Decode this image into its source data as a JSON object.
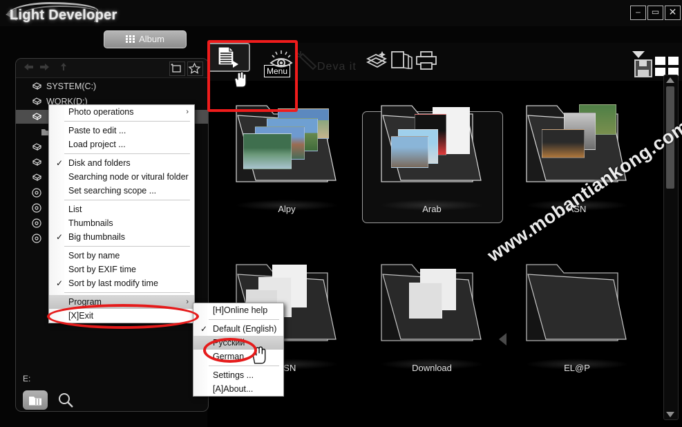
{
  "window": {
    "title": "Light Developer",
    "minimize_label": "–",
    "maximize_label": "▭",
    "close_label": "✕"
  },
  "tabs": {
    "album_label": "Album"
  },
  "toolbar": {
    "menu_tooltip": "Menu",
    "deva_label": "Deva it",
    "icons": [
      "menu-document-icon",
      "eye-preview-icon",
      "magic-wand-icon",
      "layers-icon",
      "copy-pages-icon",
      "print-icon"
    ],
    "right_icons": [
      "dropdown-triangle-icon",
      "save-floppy-icon",
      "grid-view-icon"
    ]
  },
  "browser": {
    "nav": {
      "back": "←",
      "forward": "→",
      "up": "↑"
    },
    "new_folder_icon": "new-folder-icon",
    "favorite_icon": "star-icon",
    "tree": [
      {
        "label": "SYSTEM(C:)",
        "icon": "disk-icon",
        "selected": false,
        "indent": false
      },
      {
        "label": "WORK(D:)",
        "icon": "disk-icon",
        "selected": false,
        "indent": false
      },
      {
        "label": "",
        "icon": "disk-icon",
        "selected": true,
        "indent": false
      },
      {
        "label": "",
        "icon": "folder-icon",
        "selected": false,
        "indent": true
      },
      {
        "label": "",
        "icon": "disk-icon",
        "selected": false,
        "indent": false
      },
      {
        "label": "",
        "icon": "disk-icon",
        "selected": false,
        "indent": false
      },
      {
        "label": "",
        "icon": "disk-icon",
        "selected": false,
        "indent": false
      },
      {
        "label": "",
        "icon": "disc-icon",
        "selected": false,
        "indent": false
      },
      {
        "label": "",
        "icon": "disc-icon",
        "selected": false,
        "indent": false
      },
      {
        "label": "",
        "icon": "disc-icon",
        "selected": false,
        "indent": false
      },
      {
        "label": "",
        "icon": "disc-icon",
        "selected": false,
        "indent": false
      }
    ],
    "path_value": "E:",
    "folder_button_icon": "folder-browse-icon",
    "search_button_icon": "search-icon"
  },
  "context_menu": {
    "items": [
      {
        "label": "Photo operations",
        "checked": false,
        "submenu": true,
        "separator_after": true
      },
      {
        "label": "Paste to edit ...",
        "checked": false,
        "submenu": false,
        "separator_after": false
      },
      {
        "label": "Load project ...",
        "checked": false,
        "submenu": false,
        "separator_after": true
      },
      {
        "label": "Disk and folders",
        "checked": true,
        "submenu": false,
        "separator_after": false
      },
      {
        "label": "Searching node or vitural folder",
        "checked": false,
        "submenu": false,
        "separator_after": false
      },
      {
        "label": "Set searching scope ...",
        "checked": false,
        "submenu": false,
        "separator_after": true
      },
      {
        "label": "List",
        "checked": false,
        "submenu": false,
        "separator_after": false
      },
      {
        "label": "Thumbnails",
        "checked": false,
        "submenu": false,
        "separator_after": false
      },
      {
        "label": "Big thumbnails",
        "checked": true,
        "submenu": false,
        "separator_after": true
      },
      {
        "label": "Sort by name",
        "checked": false,
        "submenu": false,
        "separator_after": false
      },
      {
        "label": "Sort by EXIF time",
        "checked": false,
        "submenu": false,
        "separator_after": false
      },
      {
        "label": "Sort by last modify time",
        "checked": true,
        "submenu": false,
        "separator_after": true
      },
      {
        "label": "Program",
        "checked": false,
        "submenu": true,
        "separator_after": false,
        "highlighted": true
      },
      {
        "label": "[X]Exit",
        "checked": false,
        "submenu": false,
        "separator_after": false
      }
    ],
    "check_glyph": "✓",
    "submenu_glyph": "›"
  },
  "program_submenu": {
    "items": [
      {
        "label": "[H]Online help",
        "checked": false,
        "separator_after": true
      },
      {
        "label": "Default (English)",
        "checked": true,
        "separator_after": false
      },
      {
        "label": "Русский",
        "checked": false,
        "separator_after": false,
        "highlighted": true
      },
      {
        "label": "German",
        "checked": false,
        "separator_after": true
      },
      {
        "label": "Settings ...",
        "checked": false,
        "separator_after": false
      },
      {
        "label": "[A]About...",
        "checked": false,
        "separator_after": false
      }
    ]
  },
  "folders": [
    {
      "name": "Alpy",
      "selected": false
    },
    {
      "name": "Arab",
      "selected": true
    },
    {
      "name": "ASN",
      "selected": false
    },
    {
      "name": "ASN",
      "selected": false
    },
    {
      "name": "Download",
      "selected": false
    },
    {
      "name": "EL@P",
      "selected": false
    }
  ],
  "nav_arrow_icon": "left-arrow-icon",
  "scrollbar": {
    "up_icon": "scroll-up-arrow-icon",
    "down_icon": "scroll-down-arrow-icon"
  },
  "watermark": {
    "text": "www.mobantiankong.com"
  },
  "colors": {
    "annotation_red": "#ef1c1c",
    "background": "#000000",
    "menu_background": "#ffffff",
    "accent_gray": "#9b9b9b"
  }
}
